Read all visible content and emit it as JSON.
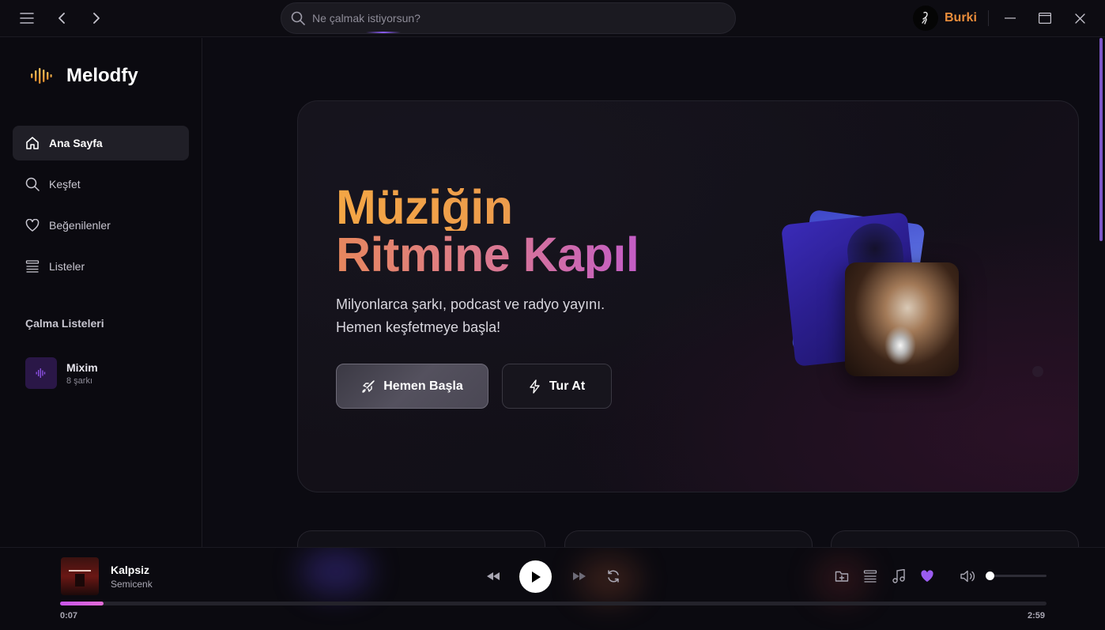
{
  "titlebar": {
    "search_placeholder": "Ne çalmak istiyorsun?",
    "username": "Burki"
  },
  "sidebar": {
    "brand": "Melodfy",
    "nav": [
      {
        "label": "Ana Sayfa",
        "icon": "home-icon",
        "active": true
      },
      {
        "label": "Keşfet",
        "icon": "search-icon",
        "active": false
      },
      {
        "label": "Beğenilenler",
        "icon": "heart-icon",
        "active": false
      },
      {
        "label": "Listeler",
        "icon": "list-icon",
        "active": false
      }
    ],
    "playlists_title": "Çalma Listeleri",
    "playlists": [
      {
        "name": "Mixim",
        "count": "8 şarkı"
      }
    ]
  },
  "hero": {
    "title_line1": "Müziğin",
    "title_line2": "Ritmine Kapıl",
    "subtitle_line1": "Milyonlarca şarkı, podcast ve radyo yayını.",
    "subtitle_line2": "Hemen keşfetmeye başla!",
    "primary_button": "Hemen Başla",
    "secondary_button": "Tur At"
  },
  "player": {
    "track_title": "Kalpsiz",
    "artist": "Semicenk",
    "elapsed": "0:07",
    "duration": "2:59",
    "progress_fraction": 0.044,
    "volume_fraction": 0.0,
    "liked": true
  },
  "colors": {
    "accent_purple": "#9b5cf0",
    "title_orange": "#f4a645",
    "title_pink": "#c35dc6",
    "username": "#ea8d3b"
  }
}
